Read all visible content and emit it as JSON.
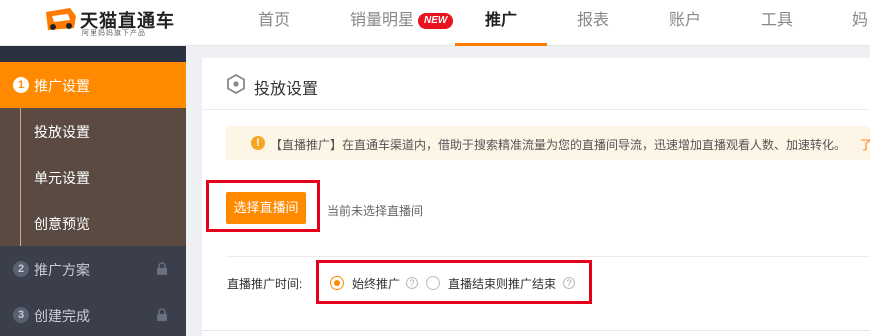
{
  "brand": {
    "title": "天猫直通车",
    "subtitle": "阿里妈妈旗下产品",
    "colors": {
      "accent": "#ff8a00",
      "sidebar": "#3a3f4b",
      "substeps": "#5a4a42",
      "badge": "#e8131e",
      "highlight": "#e3001b"
    }
  },
  "nav": {
    "items": [
      {
        "label": "首页"
      },
      {
        "label": "销量明星",
        "badge": "NEW"
      },
      {
        "label": "推广",
        "active": true
      },
      {
        "label": "报表"
      },
      {
        "label": "账户"
      },
      {
        "label": "工具"
      },
      {
        "label": "妈"
      }
    ]
  },
  "sidebar": {
    "steps": [
      {
        "num": "1",
        "label": "推广设置",
        "active": true
      },
      {
        "num": "2",
        "label": "推广方案",
        "locked": true,
        "icon": "lock-icon"
      },
      {
        "num": "3",
        "label": "创建完成",
        "locked": true,
        "icon": "lock-icon"
      }
    ],
    "substeps": [
      {
        "label": "投放设置"
      },
      {
        "label": "单元设置"
      },
      {
        "label": "创意预览"
      }
    ]
  },
  "main": {
    "title": "投放设置",
    "title_icon": "hexagon-icon",
    "notice": {
      "icon": "warning-icon",
      "text": "【直播推广】在直通车渠道内，借助于搜索精准流量为您的直播间导流，迅速增加直播观看人数、加速转化。",
      "more": "了"
    },
    "choose_button": "选择直播间",
    "choose_hint": "当前未选择直播间",
    "time_label": "直播推广时间:",
    "radios": [
      {
        "label": "始终推广",
        "checked": true,
        "help": "?"
      },
      {
        "label": "直播结束则推广结束",
        "checked": false,
        "help": "?"
      }
    ]
  }
}
